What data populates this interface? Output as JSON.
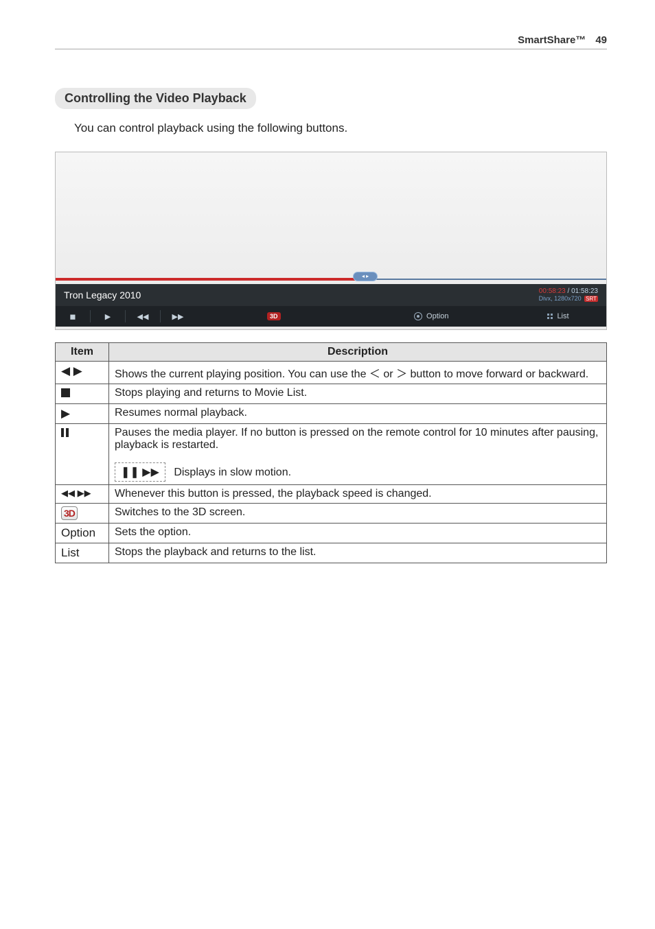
{
  "header": {
    "title": "SmartShare™",
    "page": "49"
  },
  "section": {
    "title": "Controlling the Video Playback",
    "intro": "You can control playback using the following buttons."
  },
  "player": {
    "video_title": "Tron Legacy 2010",
    "scrub_glyphs": "◂ ▸",
    "time_current": "00:58:23",
    "time_total": " / 01:58:23",
    "meta": "Divx, 1280x720",
    "meta_badge": "SRT",
    "controls": {
      "stop": "◼",
      "play": "▶",
      "rew": "◀◀",
      "ff": "▶▶",
      "three_d": "3D",
      "option": "Option",
      "list": "List"
    }
  },
  "table": {
    "h_item": "Item",
    "h_desc": "Description",
    "rows": {
      "seek": {
        "icon": "◀ ▶",
        "text_a": "Shows the current playing position. You can use the ",
        "lt": "＜",
        "mid": " or ",
        "gt": "＞",
        "text_b": " button to move forward or backward."
      },
      "stop": {
        "text": "Stops playing and returns to Movie List."
      },
      "play": {
        "icon": "▶",
        "text": "Resumes normal playback."
      },
      "pause": {
        "text": "Pauses the media player. If no button is pressed on the remote control for 10 minutes after pausing, playback is restarted.",
        "slow_icon": "❚❚ ▶▶",
        "slow_text": " Displays in slow motion."
      },
      "speed": {
        "icon": "◀◀ ▶▶",
        "text": "Whenever this button is pressed, the playback speed is changed."
      },
      "three_d": {
        "icon": "3D",
        "text": "Switches to the 3D screen."
      },
      "option": {
        "label": "Option",
        "text": "Sets the option."
      },
      "list": {
        "label": "List",
        "text": "Stops the playback and returns to the list."
      }
    }
  }
}
